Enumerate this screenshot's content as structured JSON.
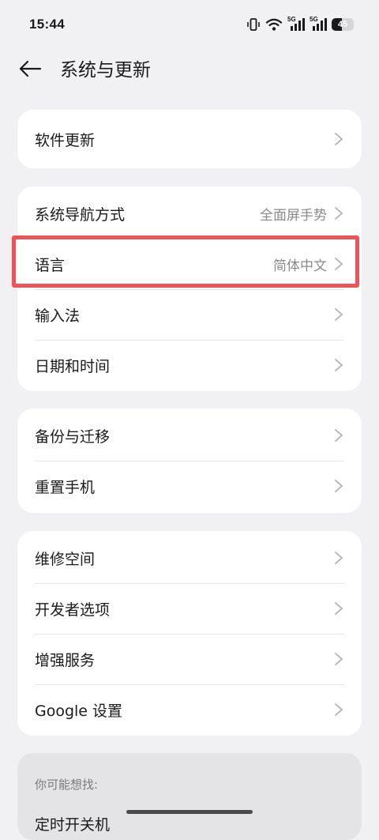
{
  "status_bar": {
    "time": "15:44",
    "signal_1_label": "5G",
    "signal_2_label": "5G",
    "battery_level": "45",
    "battery_fraction": 0.45
  },
  "header": {
    "title": "系统与更新"
  },
  "groups": [
    {
      "items": [
        {
          "label": "软件更新",
          "value": ""
        }
      ]
    },
    {
      "items": [
        {
          "label": "系统导航方式",
          "value": "全面屏手势"
        },
        {
          "label": "语言",
          "value": "简体中文"
        },
        {
          "label": "输入法",
          "value": ""
        },
        {
          "label": "日期和时间",
          "value": ""
        }
      ]
    },
    {
      "items": [
        {
          "label": "备份与迁移",
          "value": ""
        },
        {
          "label": "重置手机",
          "value": ""
        }
      ]
    },
    {
      "items": [
        {
          "label": "维修空间",
          "value": ""
        },
        {
          "label": "开发者选项",
          "value": ""
        },
        {
          "label": "增强服务",
          "value": ""
        },
        {
          "label": "Google 设置",
          "value": ""
        }
      ]
    }
  ],
  "suggestions": {
    "heading": "你可能想找:",
    "items": [
      "定时开关机"
    ]
  },
  "colors": {
    "background": "#f1f1f3",
    "card": "#ffffff",
    "highlight": "#f0525a",
    "secondary_text": "#8a8a8c"
  }
}
